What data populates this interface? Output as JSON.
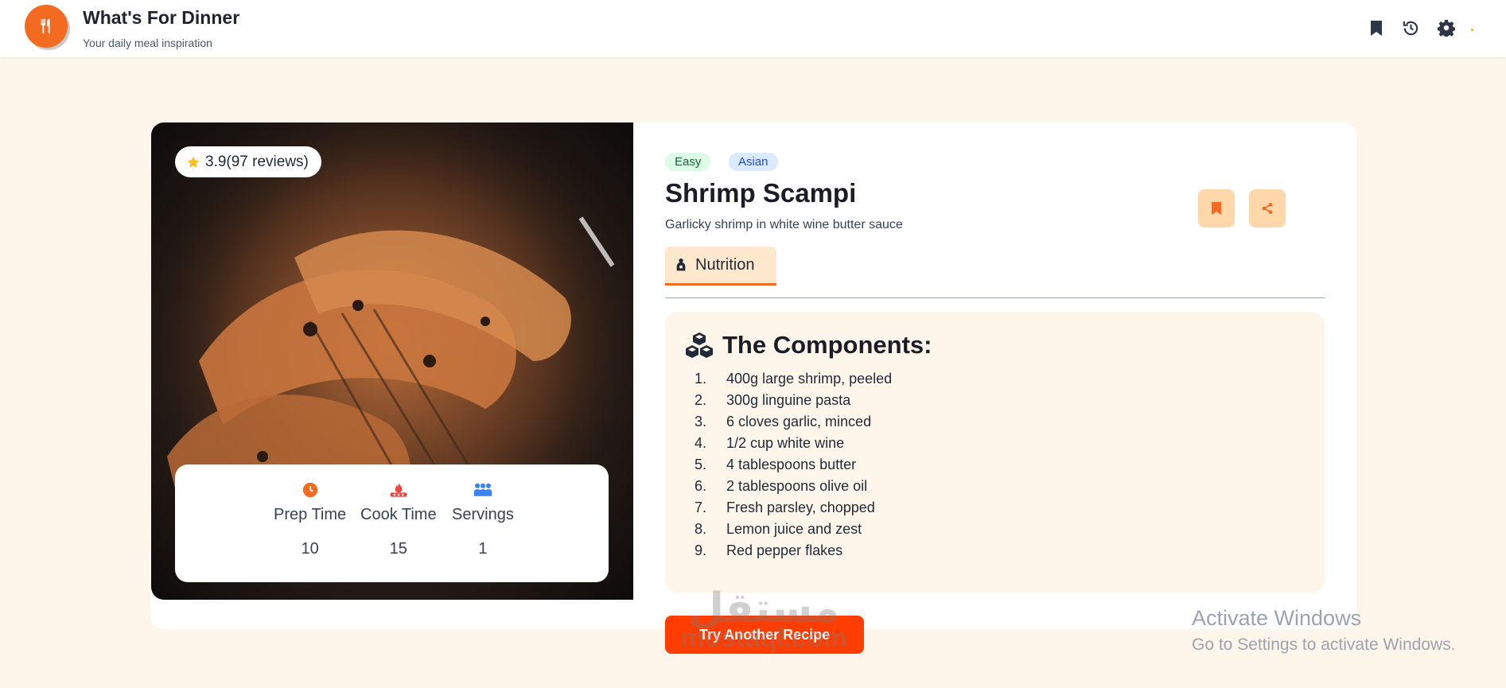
{
  "app": {
    "title": "What's For Dinner",
    "subtitle": "Your daily meal inspiration",
    "brand_color": "#f26b21"
  },
  "header": {
    "icons": [
      "bookmark-icon",
      "history-icon",
      "settings-icon"
    ]
  },
  "recipe": {
    "rating": "3.9(97 reviews)",
    "badges": {
      "difficulty": "Easy",
      "cuisine": "Asian"
    },
    "title": "Shrimp Scampi",
    "description": "Garlicky shrimp in white wine butter sauce",
    "stats": {
      "prep_label": "Prep Time",
      "prep_value": "10",
      "cook_label": "Cook Time",
      "cook_value": "15",
      "servings_label": "Servings",
      "servings_value": "1"
    }
  },
  "tabs": {
    "nutrition": "Nutrition"
  },
  "components": {
    "heading": "The Components:",
    "items": [
      "400g large shrimp, peeled",
      "300g linguine pasta",
      "6 cloves garlic, minced",
      "1/2 cup white wine",
      "4 tablespoons butter",
      "2 tablespoons olive oil",
      "Fresh parsley, chopped",
      "Lemon juice and zest",
      "Red pepper flakes"
    ]
  },
  "actions": {
    "try_another": "Try Another Recipe"
  },
  "watermark": {
    "arabic": "مستقل",
    "latin": "mostaql.com"
  },
  "windows": {
    "line1": "Activate Windows",
    "line2": "Go to Settings to activate Windows."
  }
}
